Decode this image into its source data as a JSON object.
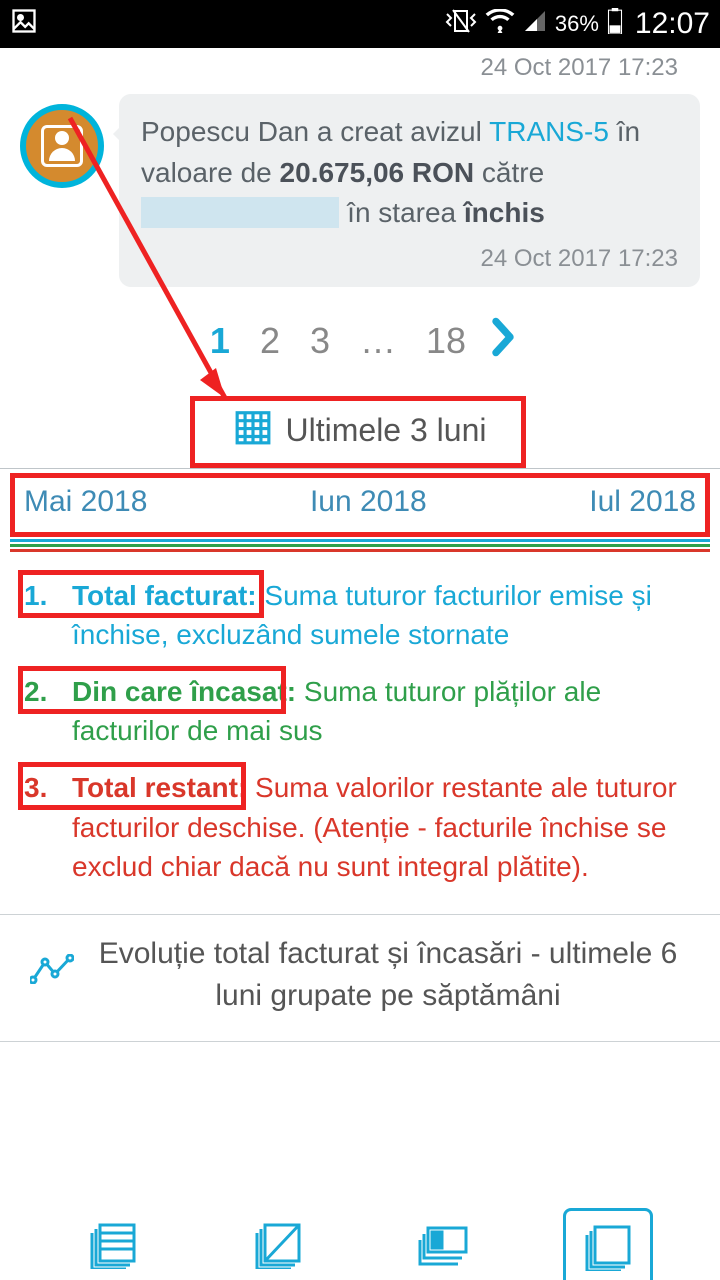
{
  "status": {
    "battery_pct": "36%",
    "clock": "12:07"
  },
  "feed": {
    "prev_timestamp": "24 Oct 2017 17:23",
    "msg": {
      "t1": "Popescu Dan a creat avizul ",
      "link": "TRANS-5",
      "t2": " în valoare de ",
      "amount": "20.675,06 RON",
      "t3": " către ",
      "redacted": "██████████",
      "t4": " în starea ",
      "state": "închis",
      "timestamp": "24 Oct 2017 17:23"
    }
  },
  "pagination": {
    "p1": "1",
    "p2": "2",
    "p3": "3",
    "ellipsis": "…",
    "last": "18"
  },
  "section": {
    "title": "Ultimele 3 luni",
    "months": {
      "m1": "Mai 2018",
      "m2": "Iun 2018",
      "m3": "Iul 2018"
    }
  },
  "legend": {
    "i1": {
      "num": "1.",
      "term": "Total facturat:",
      "desc": " Suma tuturor facturilor emise și închise, excluzând sumele stornate"
    },
    "i2": {
      "num": "2.",
      "term": "Din care încasat:",
      "desc": " Suma tuturor plăților ale facturilor de mai sus"
    },
    "i3": {
      "num": "3.",
      "term": "Total restant:",
      "desc": " Suma valorilor restante ale tuturor facturilor deschise. (Atenție - facturile închise se exclud chiar dacă nu sunt integral plătite)."
    }
  },
  "evo": {
    "title": "Evoluție total facturat și încasări - ultimele 6 luni grupate pe săptămâni"
  }
}
